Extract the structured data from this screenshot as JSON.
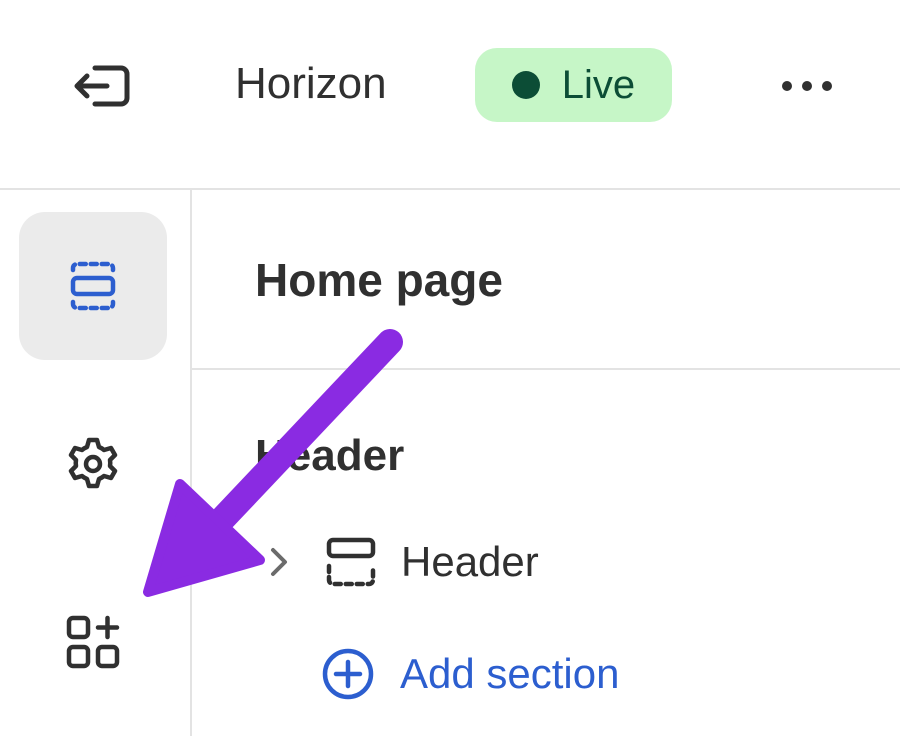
{
  "topbar": {
    "theme_name": "Horizon",
    "status_label": "Live",
    "status_color": "#c6f6c7",
    "status_dot_color": "#0c4d36",
    "icons": [
      "exit-icon",
      "more-horizontal-icon"
    ]
  },
  "rail": {
    "items": [
      {
        "icon": "sections-icon",
        "active": true
      },
      {
        "icon": "gear-icon",
        "active": false
      },
      {
        "icon": "apps-add-icon",
        "active": false
      }
    ],
    "accent_color": "#2c5ecf"
  },
  "panel": {
    "title": "Home page",
    "group_title": "Header",
    "tree": [
      {
        "label": "Header",
        "icon": "header-section-icon",
        "expand_icon": "chevron-right-icon"
      }
    ],
    "add_section_label": "Add section",
    "add_section_icon": "plus-circle-icon",
    "link_color": "#2c5ecf"
  },
  "annotation": {
    "arrow_color": "#8a2be2",
    "points_to": "apps-add-icon"
  }
}
